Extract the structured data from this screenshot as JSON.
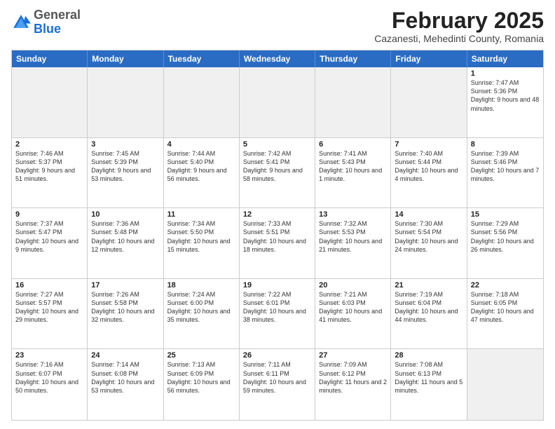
{
  "logo": {
    "general": "General",
    "blue": "Blue"
  },
  "header": {
    "title": "February 2025",
    "location": "Cazanesti, Mehedinti County, Romania"
  },
  "weekdays": [
    "Sunday",
    "Monday",
    "Tuesday",
    "Wednesday",
    "Thursday",
    "Friday",
    "Saturday"
  ],
  "weeks": [
    [
      {
        "day": "",
        "text": "",
        "shaded": true
      },
      {
        "day": "",
        "text": "",
        "shaded": true
      },
      {
        "day": "",
        "text": "",
        "shaded": true
      },
      {
        "day": "",
        "text": "",
        "shaded": true
      },
      {
        "day": "",
        "text": "",
        "shaded": true
      },
      {
        "day": "",
        "text": "",
        "shaded": true
      },
      {
        "day": "1",
        "text": "Sunrise: 7:47 AM\nSunset: 5:36 PM\nDaylight: 9 hours and 48 minutes."
      }
    ],
    [
      {
        "day": "2",
        "text": "Sunrise: 7:46 AM\nSunset: 5:37 PM\nDaylight: 9 hours and 51 minutes."
      },
      {
        "day": "3",
        "text": "Sunrise: 7:45 AM\nSunset: 5:39 PM\nDaylight: 9 hours and 53 minutes."
      },
      {
        "day": "4",
        "text": "Sunrise: 7:44 AM\nSunset: 5:40 PM\nDaylight: 9 hours and 56 minutes."
      },
      {
        "day": "5",
        "text": "Sunrise: 7:42 AM\nSunset: 5:41 PM\nDaylight: 9 hours and 58 minutes."
      },
      {
        "day": "6",
        "text": "Sunrise: 7:41 AM\nSunset: 5:43 PM\nDaylight: 10 hours and 1 minute."
      },
      {
        "day": "7",
        "text": "Sunrise: 7:40 AM\nSunset: 5:44 PM\nDaylight: 10 hours and 4 minutes."
      },
      {
        "day": "8",
        "text": "Sunrise: 7:39 AM\nSunset: 5:46 PM\nDaylight: 10 hours and 7 minutes."
      }
    ],
    [
      {
        "day": "9",
        "text": "Sunrise: 7:37 AM\nSunset: 5:47 PM\nDaylight: 10 hours and 9 minutes."
      },
      {
        "day": "10",
        "text": "Sunrise: 7:36 AM\nSunset: 5:48 PM\nDaylight: 10 hours and 12 minutes."
      },
      {
        "day": "11",
        "text": "Sunrise: 7:34 AM\nSunset: 5:50 PM\nDaylight: 10 hours and 15 minutes."
      },
      {
        "day": "12",
        "text": "Sunrise: 7:33 AM\nSunset: 5:51 PM\nDaylight: 10 hours and 18 minutes."
      },
      {
        "day": "13",
        "text": "Sunrise: 7:32 AM\nSunset: 5:53 PM\nDaylight: 10 hours and 21 minutes."
      },
      {
        "day": "14",
        "text": "Sunrise: 7:30 AM\nSunset: 5:54 PM\nDaylight: 10 hours and 24 minutes."
      },
      {
        "day": "15",
        "text": "Sunrise: 7:29 AM\nSunset: 5:56 PM\nDaylight: 10 hours and 26 minutes."
      }
    ],
    [
      {
        "day": "16",
        "text": "Sunrise: 7:27 AM\nSunset: 5:57 PM\nDaylight: 10 hours and 29 minutes."
      },
      {
        "day": "17",
        "text": "Sunrise: 7:26 AM\nSunset: 5:58 PM\nDaylight: 10 hours and 32 minutes."
      },
      {
        "day": "18",
        "text": "Sunrise: 7:24 AM\nSunset: 6:00 PM\nDaylight: 10 hours and 35 minutes."
      },
      {
        "day": "19",
        "text": "Sunrise: 7:22 AM\nSunset: 6:01 PM\nDaylight: 10 hours and 38 minutes."
      },
      {
        "day": "20",
        "text": "Sunrise: 7:21 AM\nSunset: 6:03 PM\nDaylight: 10 hours and 41 minutes."
      },
      {
        "day": "21",
        "text": "Sunrise: 7:19 AM\nSunset: 6:04 PM\nDaylight: 10 hours and 44 minutes."
      },
      {
        "day": "22",
        "text": "Sunrise: 7:18 AM\nSunset: 6:05 PM\nDaylight: 10 hours and 47 minutes."
      }
    ],
    [
      {
        "day": "23",
        "text": "Sunrise: 7:16 AM\nSunset: 6:07 PM\nDaylight: 10 hours and 50 minutes."
      },
      {
        "day": "24",
        "text": "Sunrise: 7:14 AM\nSunset: 6:08 PM\nDaylight: 10 hours and 53 minutes."
      },
      {
        "day": "25",
        "text": "Sunrise: 7:13 AM\nSunset: 6:09 PM\nDaylight: 10 hours and 56 minutes."
      },
      {
        "day": "26",
        "text": "Sunrise: 7:11 AM\nSunset: 6:11 PM\nDaylight: 10 hours and 59 minutes."
      },
      {
        "day": "27",
        "text": "Sunrise: 7:09 AM\nSunset: 6:12 PM\nDaylight: 11 hours and 2 minutes."
      },
      {
        "day": "28",
        "text": "Sunrise: 7:08 AM\nSunset: 6:13 PM\nDaylight: 11 hours and 5 minutes."
      },
      {
        "day": "",
        "text": "",
        "shaded": true
      }
    ]
  ]
}
